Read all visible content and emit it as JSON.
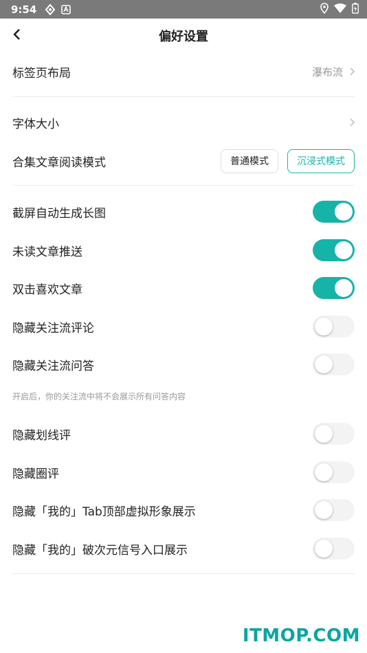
{
  "status_bar": {
    "time": "9:54"
  },
  "header": {
    "title": "偏好设置"
  },
  "layout_row": {
    "label": "标签页布局",
    "value": "瀑布流"
  },
  "font_row": {
    "label": "字体大小"
  },
  "read_mode": {
    "label": "合集文章阅读模式",
    "options": [
      "普通模式",
      "沉浸式模式"
    ],
    "selected": "沉浸式模式"
  },
  "toggles": [
    {
      "label": "截屏自动生成长图",
      "on": true
    },
    {
      "label": "未读文章推送",
      "on": true
    },
    {
      "label": "双击喜欢文章",
      "on": true
    },
    {
      "label": "隐藏关注流评论",
      "on": false
    },
    {
      "label": "隐藏关注流问答",
      "on": false
    },
    {
      "label": "隐藏划线评",
      "on": false
    },
    {
      "label": "隐藏圈评",
      "on": false
    },
    {
      "label": "隐藏「我的」Tab顶部虚拟形象展示",
      "on": false
    },
    {
      "label": "隐藏「我的」破次元信号入口展示",
      "on": false
    }
  ],
  "hint": "开启后，你的关注流中将不会展示所有问答内容",
  "watermark": "ITMOP.COM",
  "colors": {
    "accent": "#16b3a9",
    "status_bar": "#7a7a7a"
  }
}
